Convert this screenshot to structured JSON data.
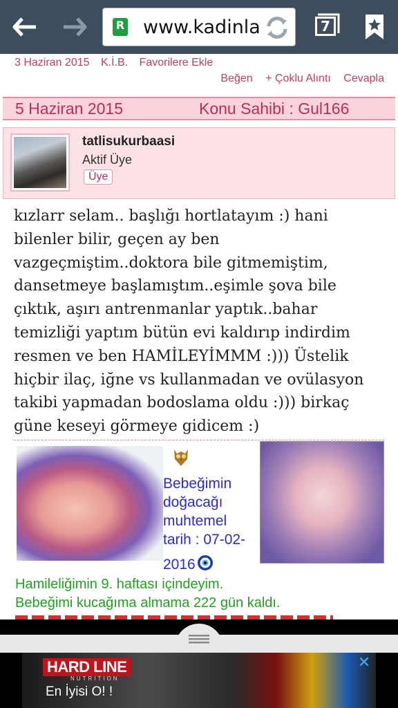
{
  "browser": {
    "url": "www.kadinla",
    "tab_count": "7",
    "favicon_letter": "R"
  },
  "post_meta": {
    "date": "3 Haziran 2015",
    "kib": "K.İ.B.",
    "favorite": "Favorilere Ekle",
    "like": "Beğen",
    "multi_quote": "+ Çoklu Alıntı",
    "reply": "Cevapla"
  },
  "post": {
    "date": "5 Haziran 2015",
    "owner": "Konu Sahibi : Gul166",
    "username": "tatlisukurbaasi",
    "user_title": "Aktif Üye",
    "role": "Üye",
    "body_lines": [
      "kızlarr selam.. başlığı hortlatayım :) hani",
      "bilenler bilir, geçen ay ben",
      "vazgeçmiştim..doktora bile gitmemiştim,",
      "dansetmeye başlamıştım..eşimle şova bile",
      "çıktık, aşırı antrenmanlar yaptık..bahar",
      "temizliği yaptım bütün evi kaldırıp indirdim",
      "resmen ve ben HAMİLEYİMMM :))) Üstelik",
      "hiçbir ilaç, iğne vs kullanmadan ve ovülasyon",
      "takibi yapmadan bodoslama oldu :))) birkaç",
      "güne keseyi görmeye gidicem :)"
    ]
  },
  "signature": {
    "due_lines": [
      "Bebeğimin",
      "doğacağı",
      "muhtemel",
      "tarih : 07-02-",
      "2016"
    ],
    "week_line": "Hamileliğimin 9. haftası içindeyim.",
    "days_line": "Bebeğimi kucağıma almama 222 gün kaldı."
  },
  "ad": {
    "brand": "HARD LINE",
    "sub": "NUTRITION",
    "slogan": "En İyisi O! !",
    "close": "✕"
  }
}
